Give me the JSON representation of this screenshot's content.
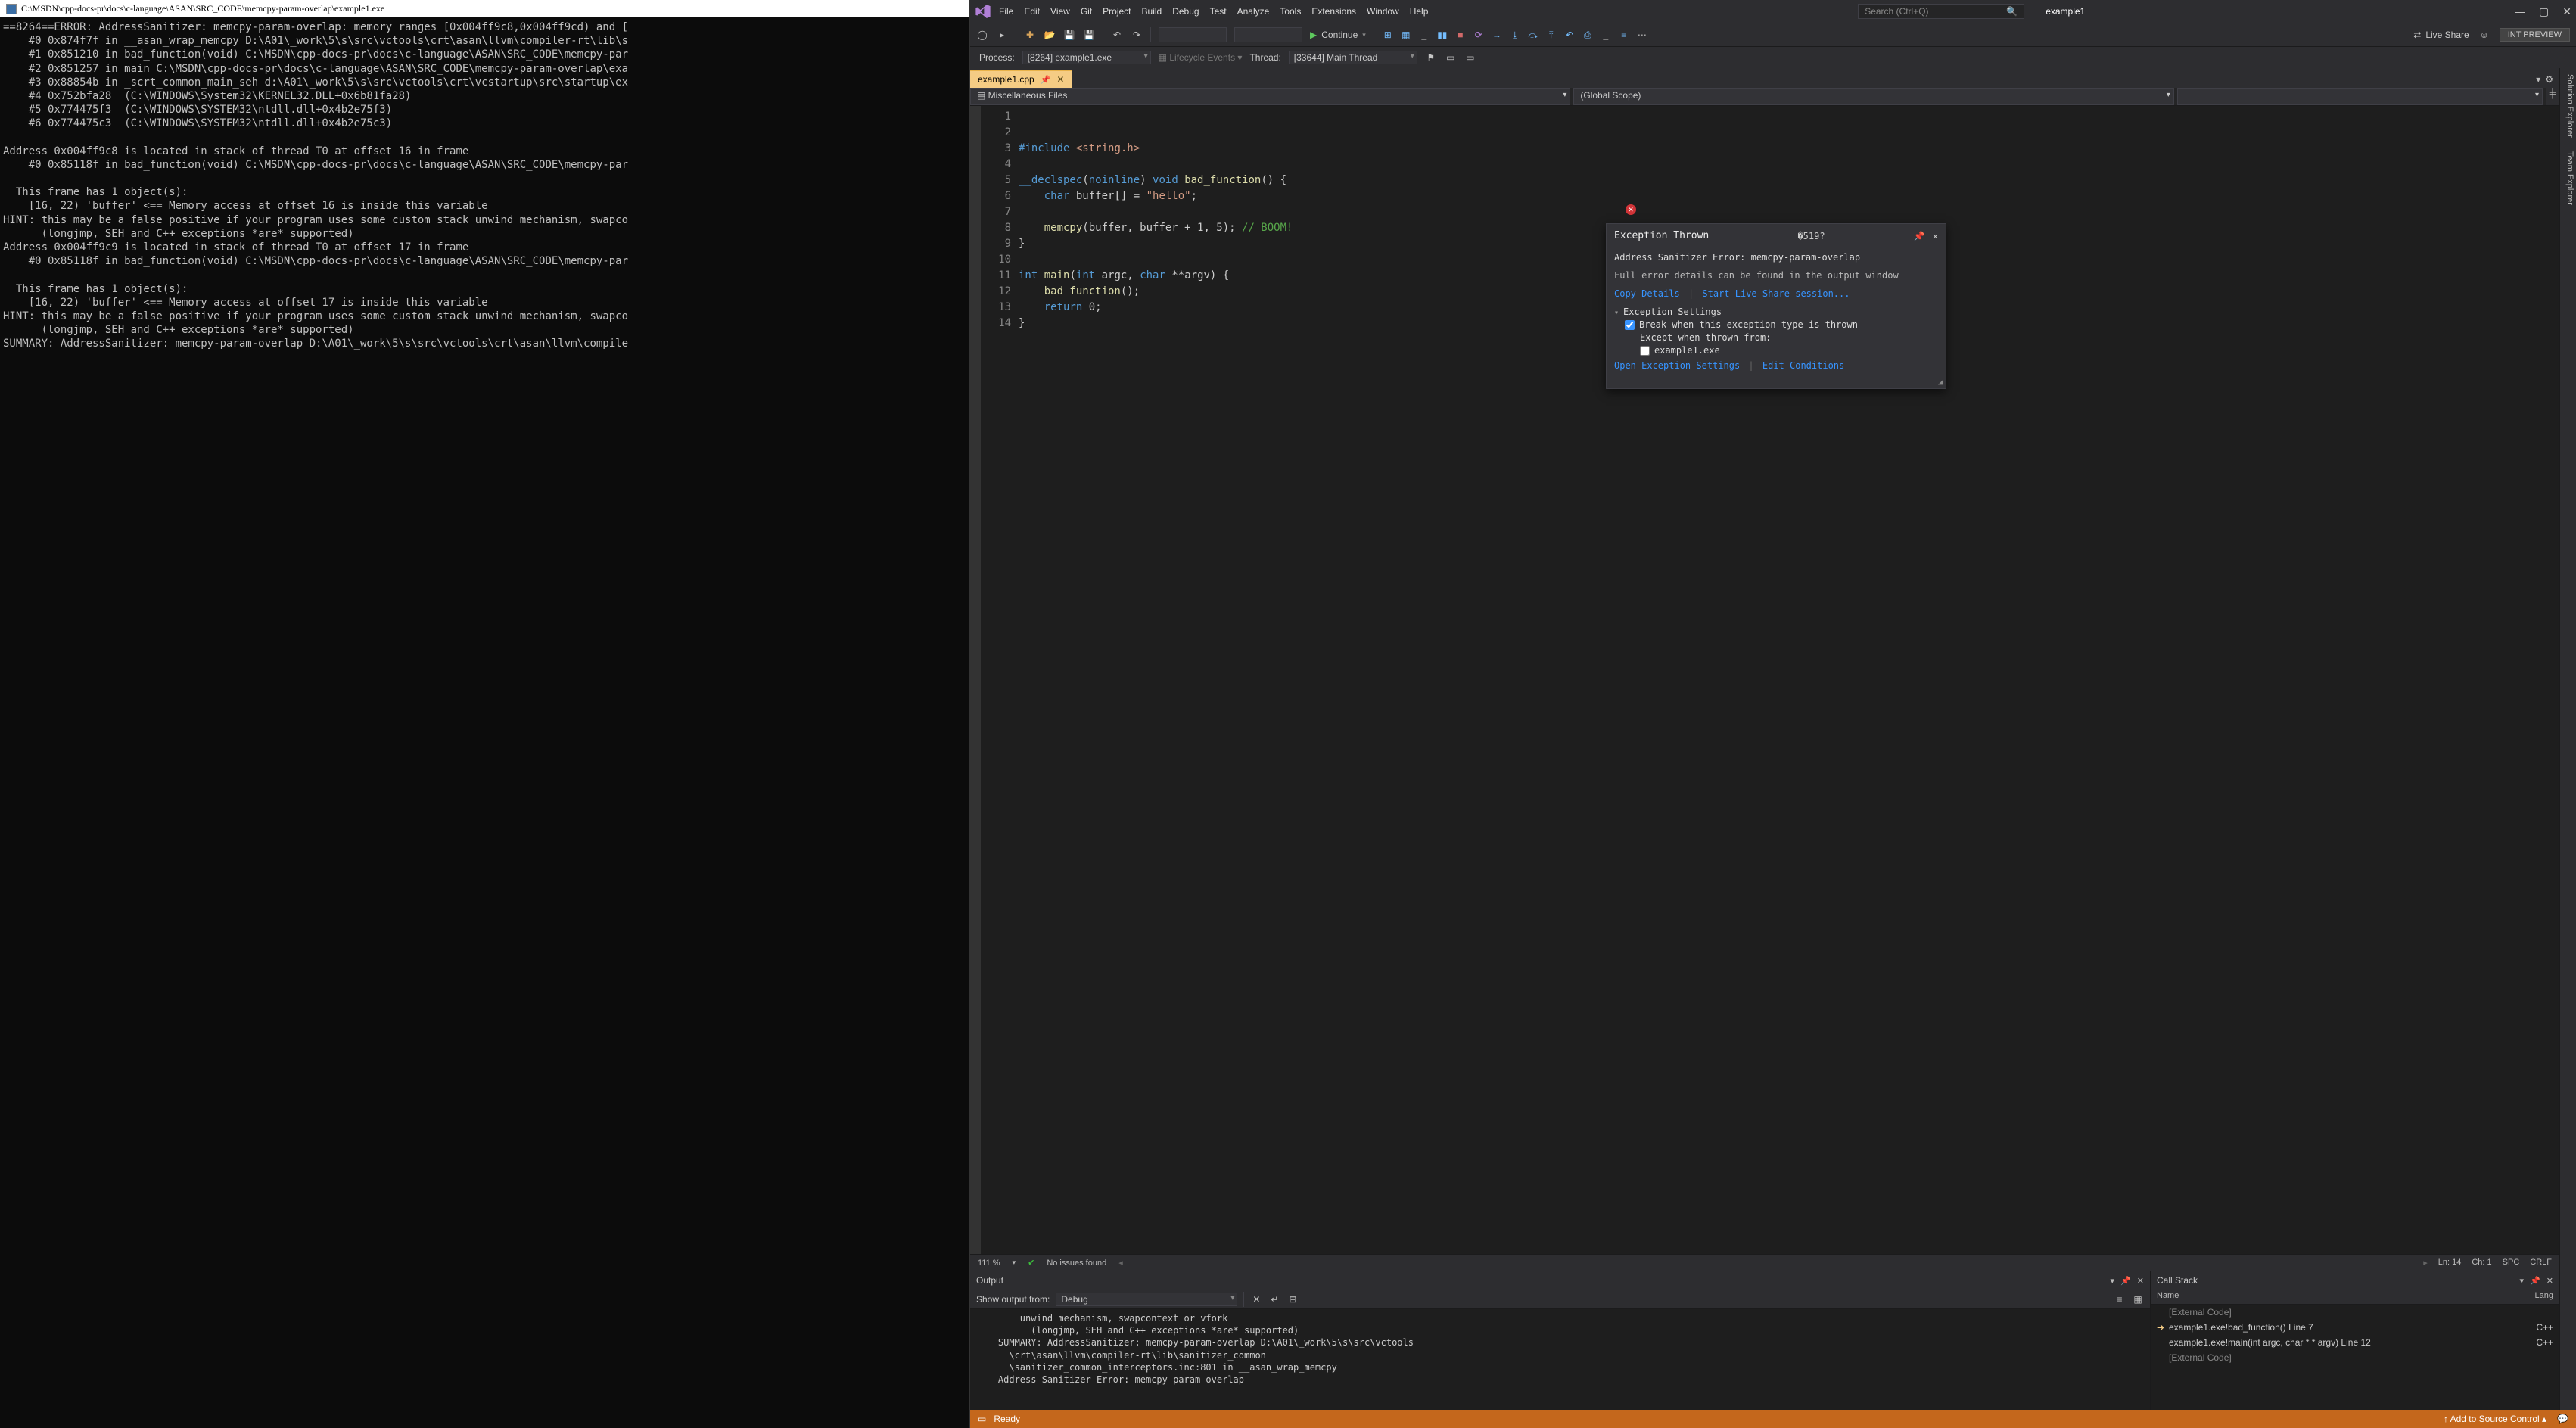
{
  "console": {
    "title": "C:\\MSDN\\cpp-docs-pr\\docs\\c-language\\ASAN\\SRC_CODE\\memcpy-param-overlap\\example1.exe",
    "body": "==8264==ERROR: AddressSanitizer: memcpy-param-overlap: memory ranges [0x004ff9c8,0x004ff9cd) and [\n    #0 0x874f7f in __asan_wrap_memcpy D:\\A01\\_work\\5\\s\\src\\vctools\\crt\\asan\\llvm\\compiler-rt\\lib\\s\n    #1 0x851210 in bad_function(void) C:\\MSDN\\cpp-docs-pr\\docs\\c-language\\ASAN\\SRC_CODE\\memcpy-par\n    #2 0x851257 in main C:\\MSDN\\cpp-docs-pr\\docs\\c-language\\ASAN\\SRC_CODE\\memcpy-param-overlap\\exa\n    #3 0x88854b in _scrt_common_main_seh d:\\A01\\_work\\5\\s\\src\\vctools\\crt\\vcstartup\\src\\startup\\ex\n    #4 0x752bfa28  (C:\\WINDOWS\\System32\\KERNEL32.DLL+0x6b81fa28)\n    #5 0x774475f3  (C:\\WINDOWS\\SYSTEM32\\ntdll.dll+0x4b2e75f3)\n    #6 0x774475c3  (C:\\WINDOWS\\SYSTEM32\\ntdll.dll+0x4b2e75c3)\n\nAddress 0x004ff9c8 is located in stack of thread T0 at offset 16 in frame\n    #0 0x85118f in bad_function(void) C:\\MSDN\\cpp-docs-pr\\docs\\c-language\\ASAN\\SRC_CODE\\memcpy-par\n\n  This frame has 1 object(s):\n    [16, 22) 'buffer' <== Memory access at offset 16 is inside this variable\nHINT: this may be a false positive if your program uses some custom stack unwind mechanism, swapco\n      (longjmp, SEH and C++ exceptions *are* supported)\nAddress 0x004ff9c9 is located in stack of thread T0 at offset 17 in frame\n    #0 0x85118f in bad_function(void) C:\\MSDN\\cpp-docs-pr\\docs\\c-language\\ASAN\\SRC_CODE\\memcpy-par\n\n  This frame has 1 object(s):\n    [16, 22) 'buffer' <== Memory access at offset 17 is inside this variable\nHINT: this may be a false positive if your program uses some custom stack unwind mechanism, swapco\n      (longjmp, SEH and C++ exceptions *are* supported)\nSUMMARY: AddressSanitizer: memcpy-param-overlap D:\\A01\\_work\\5\\s\\src\\vctools\\crt\\asan\\llvm\\compile"
  },
  "vs": {
    "menus": [
      "File",
      "Edit",
      "View",
      "Git",
      "Project",
      "Build",
      "Debug",
      "Test",
      "Analyze",
      "Tools",
      "Extensions",
      "Window",
      "Help"
    ],
    "search_placeholder": "Search (Ctrl+Q)",
    "solution": "example1",
    "toolbar": {
      "continue": "Continue",
      "liveshare": "Live Share",
      "intpreview": "INT PREVIEW"
    },
    "processbar": {
      "process_lbl": "Process:",
      "process_val": "[8264] example1.exe",
      "lifecycle": "Lifecycle Events",
      "thread_lbl": "Thread:",
      "thread_val": "[33644] Main Thread"
    },
    "tab": {
      "name": "example1.cpp"
    },
    "nav": {
      "left": "Miscellaneous Files",
      "right": "(Global Scope)"
    },
    "code": {
      "lines": 14,
      "text": "\n#include <string.h>\n\n__declspec(noinline) void bad_function() {\n    char buffer[] = \"hello\";\n\n    memcpy(buffer, buffer + 1, 5); // BOOM!\n}\n\nint main(int argc, char **argv) {\n    bad_function();\n    return 0;\n}\n"
    },
    "exception": {
      "title": "Exception Thrown",
      "msg1": "Address Sanitizer Error: memcpy-param-overlap",
      "msg2": "Full error details can be found in the output window",
      "copy": "Copy Details",
      "start_ls": "Start Live Share session...",
      "settings_hdr": "Exception Settings",
      "break_lbl": "Break when this exception type is thrown",
      "except_lbl": "Except when thrown from:",
      "except_item": "example1.exe",
      "open_settings": "Open Exception Settings",
      "edit_cond": "Edit Conditions"
    },
    "editor_status": {
      "zoom": "111 %",
      "issues": "No issues found",
      "ln": "Ln: 14",
      "ch": "Ch: 1",
      "spc": "SPC",
      "crlf": "CRLF"
    },
    "right_tools": [
      "Solution Explorer",
      "Team Explorer"
    ],
    "output": {
      "title": "Output",
      "from_lbl": "Show output from:",
      "from_val": "Debug",
      "body": "        unwind mechanism, swapcontext or vfork\n          (longjmp, SEH and C++ exceptions *are* supported)\n    SUMMARY: AddressSanitizer: memcpy-param-overlap D:\\A01\\_work\\5\\s\\src\\vctools\n      \\crt\\asan\\llvm\\compiler-rt\\lib\\sanitizer_common\n      \\sanitizer_common_interceptors.inc:801 in __asan_wrap_memcpy\n    Address Sanitizer Error: memcpy-param-overlap"
    },
    "callstack": {
      "title": "Call Stack",
      "cols": {
        "name": "Name",
        "lang": "Lang"
      },
      "rows": [
        {
          "arrow": "",
          "name": "[External Code]",
          "lang": "",
          "dim": true
        },
        {
          "arrow": "➔",
          "name": "example1.exe!bad_function() Line 7",
          "lang": "C++",
          "dim": false
        },
        {
          "arrow": "",
          "name": "example1.exe!main(int argc, char * * argv) Line 12",
          "lang": "C++",
          "dim": false
        },
        {
          "arrow": "",
          "name": "[External Code]",
          "lang": "",
          "dim": true
        }
      ]
    },
    "statusbar": {
      "ready": "Ready",
      "source_ctl": "Add to Source Control"
    }
  }
}
